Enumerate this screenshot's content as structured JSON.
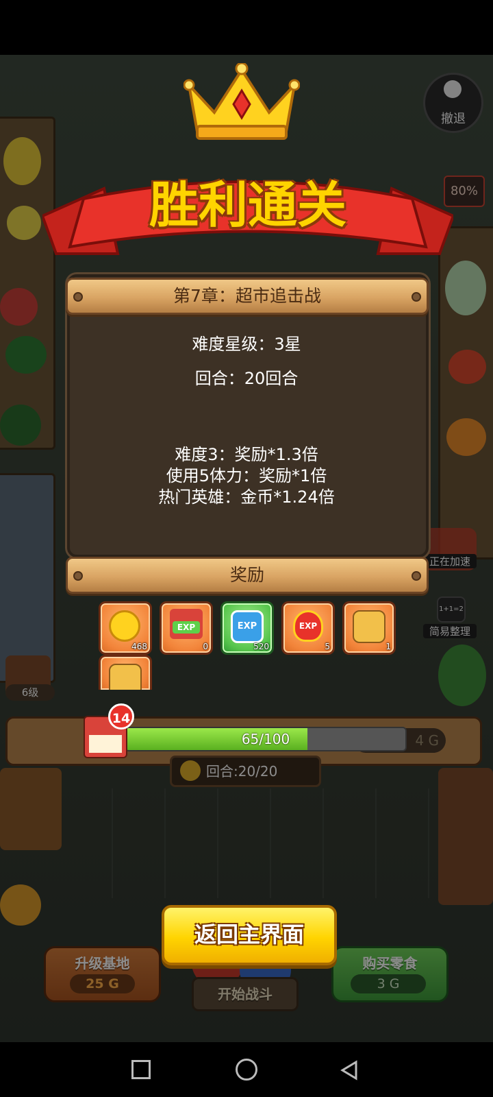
{
  "banner": {
    "title": "胜利通关"
  },
  "chapter": {
    "title": "第7章：超市追击战"
  },
  "stats": {
    "difficulty": "难度星级：3星",
    "rounds": "回合：20回合"
  },
  "bonuses": [
    "难度3：奖励*1.3倍",
    "使用5体力：奖励*1倍",
    "热门英雄：金币*1.24倍"
  ],
  "rewards_header": "奖励",
  "rewards": [
    {
      "icon": "gold-coin-icon",
      "count": "468"
    },
    {
      "icon": "shop-exp-icon",
      "count": "0"
    },
    {
      "icon": "exp-gem-icon",
      "count": "520"
    },
    {
      "icon": "exp-badge-icon",
      "count": "5"
    },
    {
      "icon": "hero-card-icon",
      "count": "1"
    },
    {
      "icon": "hero-card-icon",
      "count": ""
    }
  ],
  "shop_level": {
    "level": "14",
    "progress": "65/100",
    "value": 0.65
  },
  "left_shop_badge": "6级",
  "retreat": "撤退",
  "speedup": "正在加速",
  "simple_sort": "简易整理",
  "sort_icon_text": "1+1=2",
  "round_counter": "回合:20/20",
  "gold_display": "4 G",
  "sign_text": "80%",
  "return_button": "返回主界面",
  "upgrade_base": {
    "label": "升级基地",
    "cost": "25 G"
  },
  "start_battle": "开始战斗",
  "buy_food": {
    "label": "购买零食",
    "cost": "3 G"
  },
  "colors": {
    "accent_yellow": "#ffd400",
    "ribbon_red": "#e8322a",
    "progress_green": "#7ed321"
  }
}
